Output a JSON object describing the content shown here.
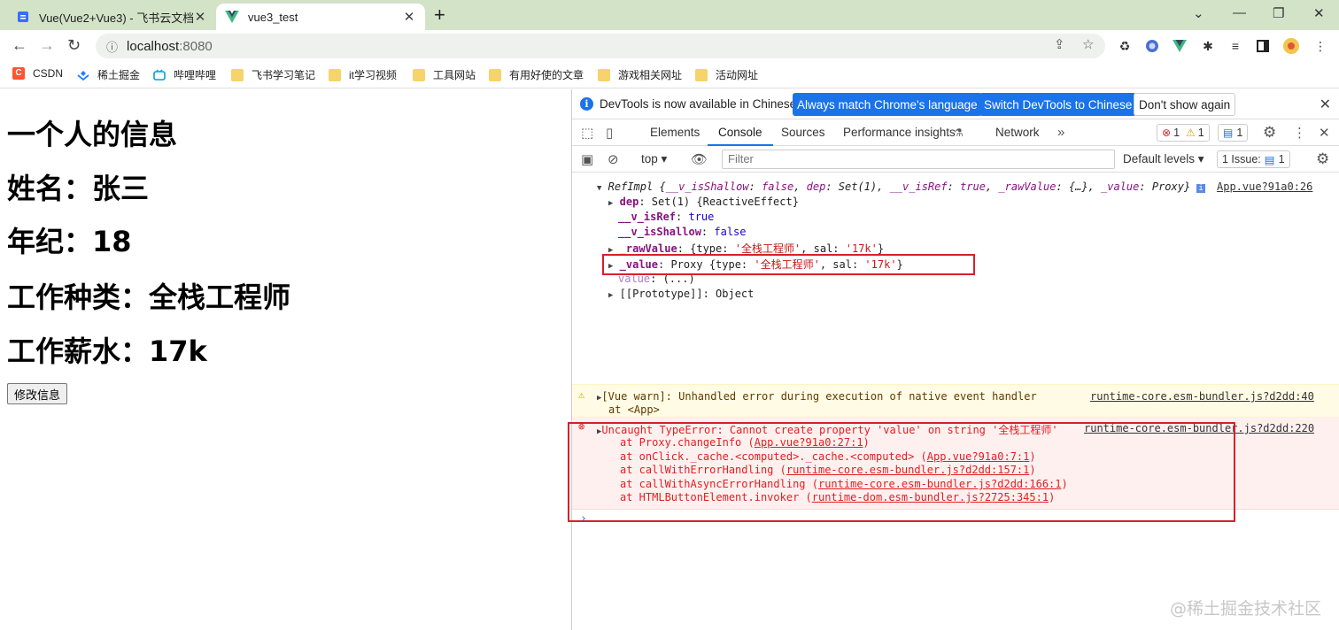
{
  "browser": {
    "tabs": [
      {
        "title": "Vue(Vue2+Vue3) - 飞书云文档"
      },
      {
        "title": "vue3_test"
      }
    ],
    "url_host": "localhost",
    "url_port": ":8080",
    "bookmarks": [
      "CSDN",
      "稀土掘金",
      "哔哩哔哩",
      "飞书学习笔记",
      "it学习视频",
      "工具网站",
      "有用好使的文章",
      "游戏相关网址",
      "活动网址"
    ]
  },
  "page": {
    "heading": "一个人的信息",
    "name_line": "姓名：张三",
    "age_line": "年纪：18",
    "job_line": "工作种类：全栈工程师",
    "salary_line": "工作薪水：17k",
    "button_label": "修改信息"
  },
  "devtools": {
    "infobar": {
      "message": "DevTools is now available in Chinese!",
      "btn_match": "Always match Chrome's language",
      "btn_switch": "Switch DevTools to Chinese",
      "btn_dismiss": "Don't show again"
    },
    "tabs": [
      "Elements",
      "Console",
      "Sources",
      "Performance insights",
      "Network"
    ],
    "counts": {
      "errors": "1",
      "warnings": "1",
      "messages": "1"
    },
    "context": "top",
    "filter_placeholder": "Filter",
    "levels": "Default levels",
    "issues_label": "1 Issue:",
    "issues_count": "1",
    "log": {
      "source1": "App.vue?91a0:26",
      "warn_source": "runtime-core.esm-bundler.js?d2dd:40",
      "warn_text": "[Vue warn]: Unhandled error during execution of native event handler",
      "warn_at": "at <App>",
      "err_source": "runtime-core.esm-bundler.js?d2dd:220",
      "err_text": "Uncaught TypeError: Cannot create property 'value' on string '全栈工程师'"
    }
  },
  "watermark": "@稀土掘金技术社区"
}
